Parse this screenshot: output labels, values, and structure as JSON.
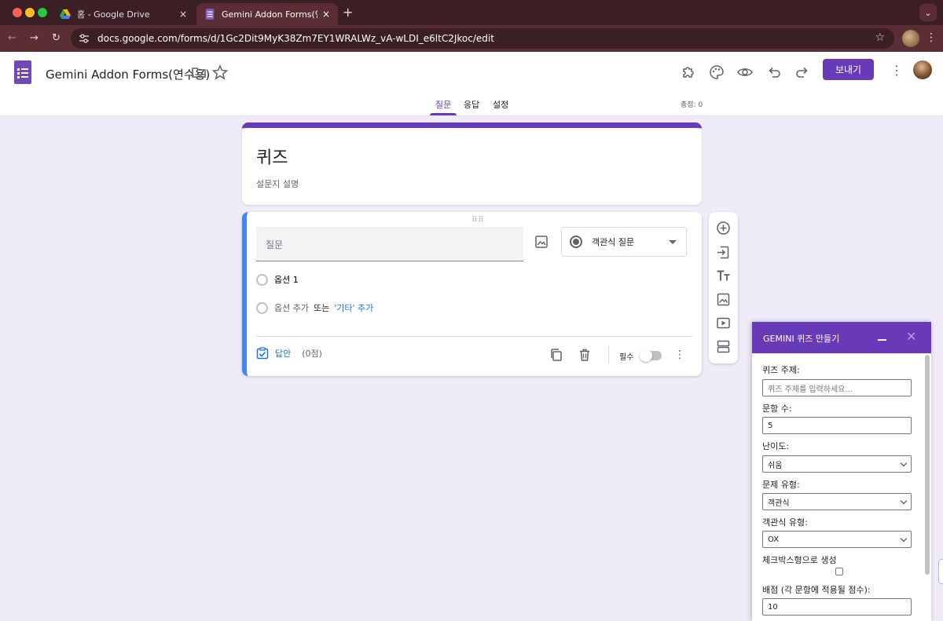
{
  "browser": {
    "tabs": [
      {
        "title": "홈 - Google Drive",
        "close": "×"
      },
      {
        "title": "Gemini Addon Forms(연수용) - Google Forms",
        "close": "×"
      }
    ],
    "new_tab": "+",
    "url": "docs.google.com/forms/d/1Gc2Dit9MyK38Zm7EY1WRALWz_vA-wLDI_e6ltC2Jkoc/edit"
  },
  "header": {
    "doc_title": "Gemini Addon Forms(연수용)",
    "send_label": "보내기",
    "tabs": [
      "질문",
      "응답",
      "설정"
    ],
    "active_tab": "질문",
    "total_points": "총점: 0"
  },
  "form": {
    "title": "퀴즈",
    "description_placeholder": "설문지 설명"
  },
  "question": {
    "placeholder": "질문",
    "type": "객관식 질문",
    "option_1": "옵션 1",
    "add_option": "옵션 추가",
    "or": "또는",
    "add_other": "'기타' 추가",
    "answer_key_label": "답안",
    "points": "(0점)",
    "required_label": "필수"
  },
  "gemini_panel": {
    "title": "GEMINI 퀴즈 만들기",
    "close": "✕",
    "fields": {
      "topic_label": "퀴즈 주제:",
      "topic_placeholder": "퀴즈 주제를 입력하세요...",
      "count_label": "문항 수:",
      "count_value": "5",
      "difficulty_label": "난이도:",
      "difficulty_value": "쉬움",
      "qtype_label": "문제 유형:",
      "qtype_value": "객관식",
      "mc_type_label": "객관식 유형:",
      "mc_type_value": "OX",
      "checkbox_label": "체크박스형으로 생성",
      "score_label": "배점 (각 문항에 적용될 점수):",
      "score_value": "10"
    }
  },
  "colors": {
    "accent": "#673ab7",
    "page_bg": "#f0ebf8",
    "link": "#1a73e8",
    "chrome_dark": "#3c1f24",
    "chrome_toolbar": "#5b2e36"
  }
}
